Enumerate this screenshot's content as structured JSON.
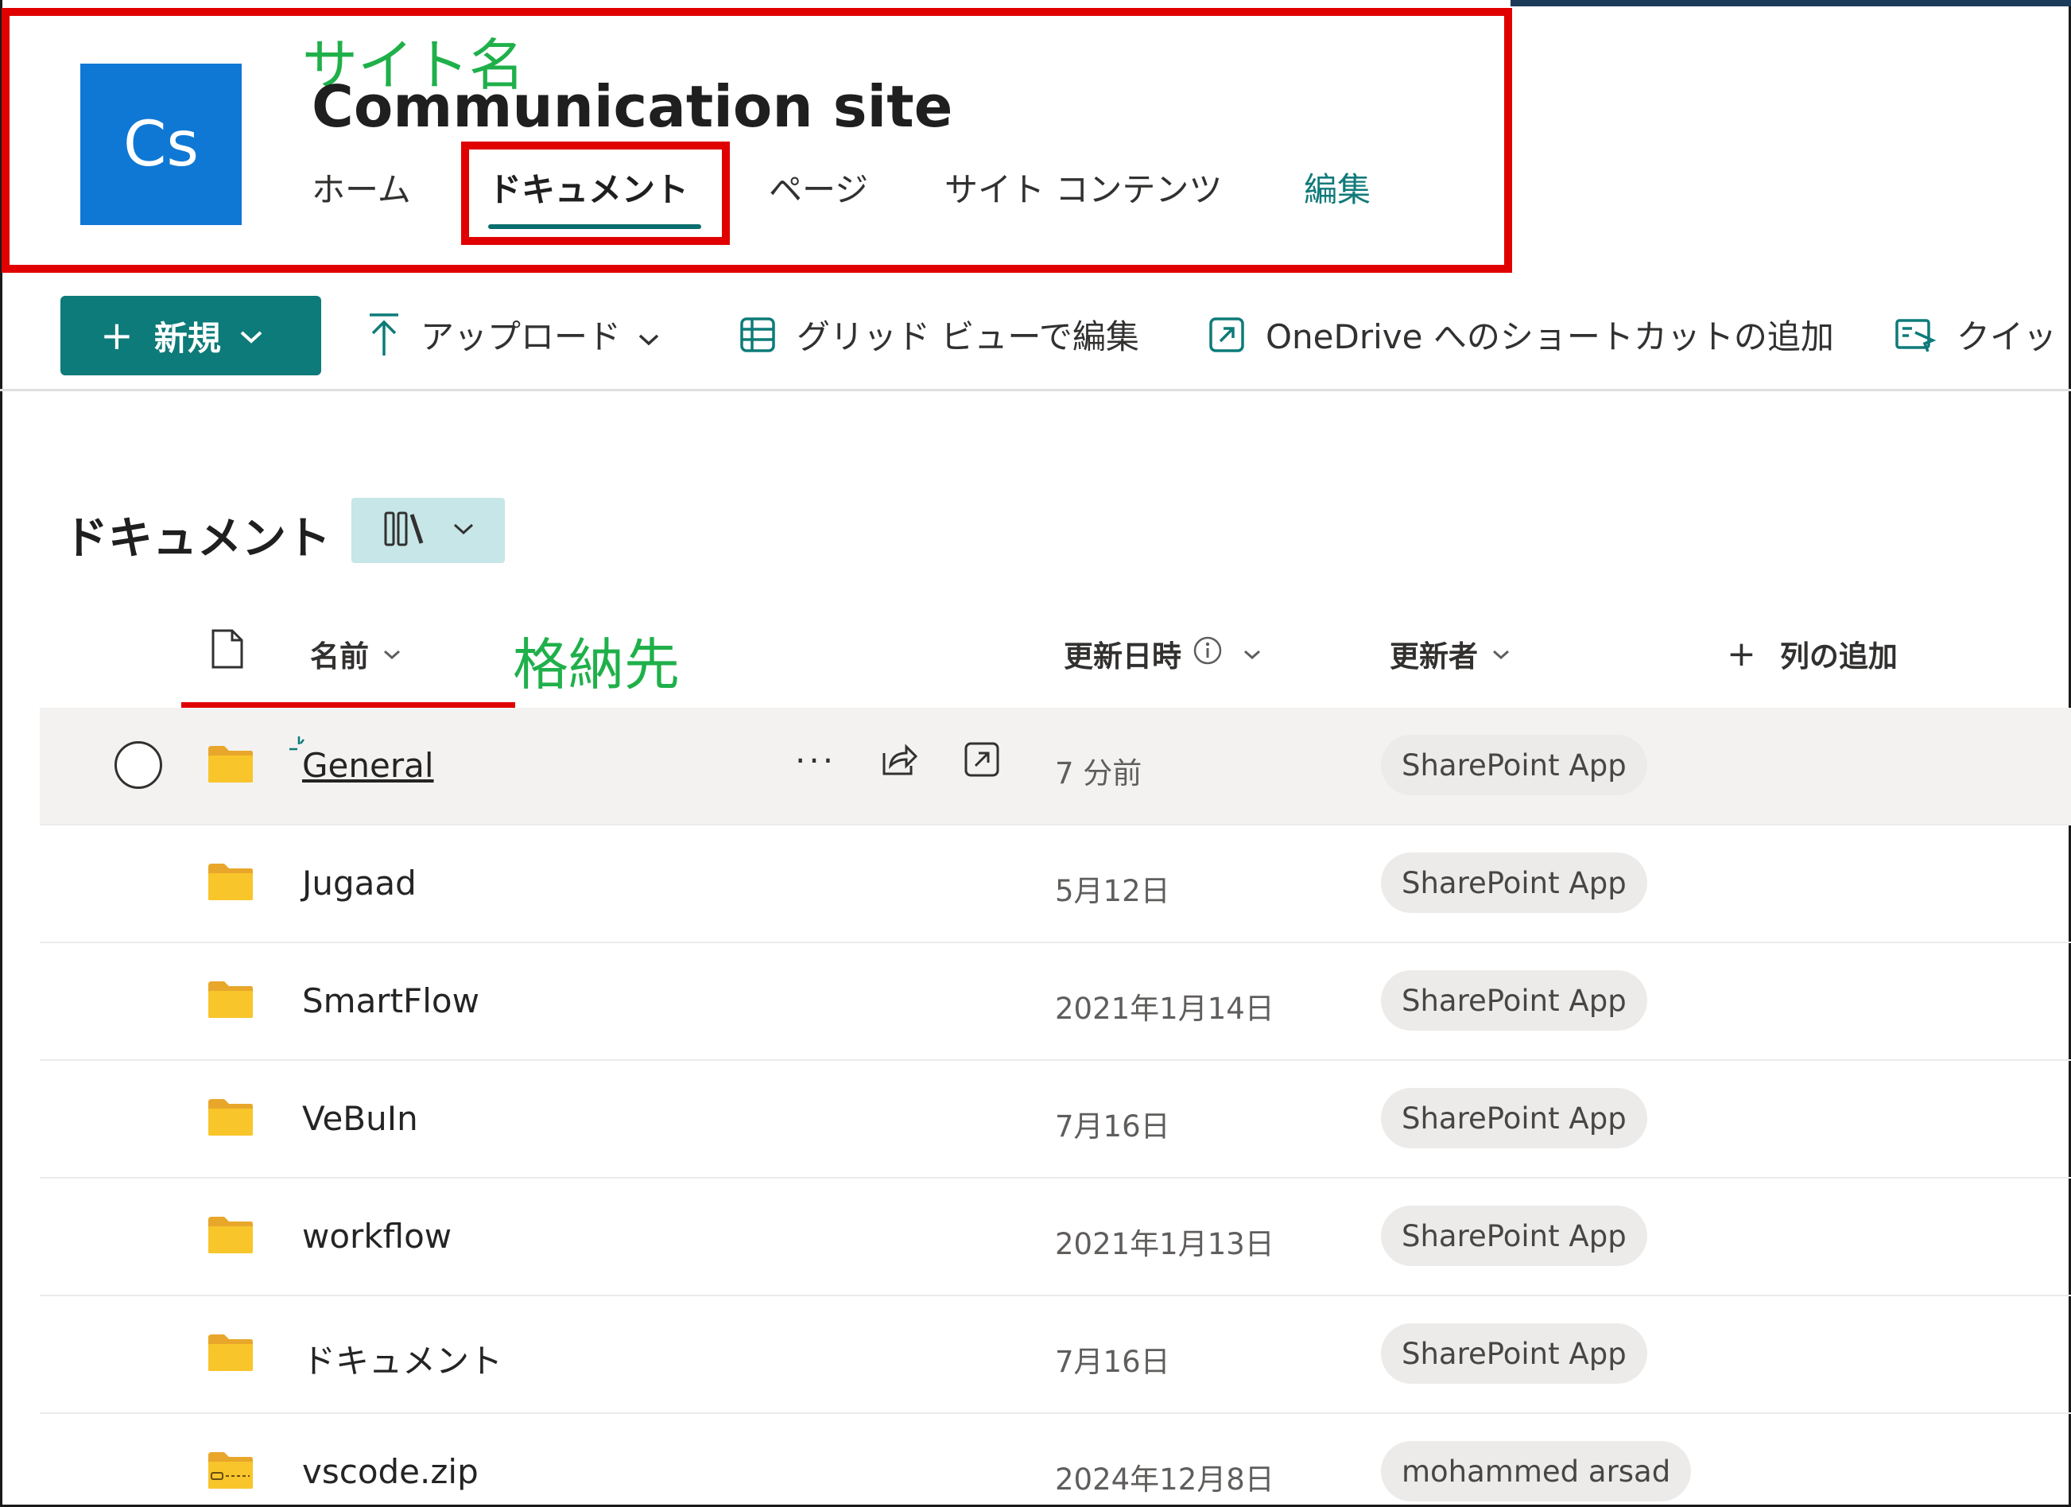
{
  "header": {
    "logo_text": "Cs",
    "site_title": "Communication site",
    "annotation_site": "サイト名",
    "nav": [
      {
        "label": "ホーム"
      },
      {
        "label": "ドキュメント"
      },
      {
        "label": "ページ"
      },
      {
        "label": "サイト コンテンツ"
      },
      {
        "label": "編集"
      }
    ]
  },
  "commandbar": {
    "new": "新規",
    "upload": "アップロード",
    "grid_edit": "グリッド ビューで編集",
    "onedrive_shortcut": "OneDrive へのショートカットの追加",
    "quick": "クイッ"
  },
  "library": {
    "title": "ドキュメント",
    "annotation_dest": "格納先",
    "columns": {
      "name": "名前",
      "modified": "更新日時",
      "modified_by": "更新者",
      "add_column": "列の追加"
    },
    "rows": [
      {
        "name": "General",
        "date": "7 分前",
        "by": "SharePoint App",
        "type": "folder"
      },
      {
        "name": "Jugaad",
        "date": "5月12日",
        "by": "SharePoint App",
        "type": "folder"
      },
      {
        "name": "SmartFlow",
        "date": "2021年1月14日",
        "by": "SharePoint App",
        "type": "folder"
      },
      {
        "name": "VeBuIn",
        "date": "7月16日",
        "by": "SharePoint App",
        "type": "folder"
      },
      {
        "name": "workflow",
        "date": "2021年1月13日",
        "by": "SharePoint App",
        "type": "folder"
      },
      {
        "name": "ドキュメント",
        "date": "7月16日",
        "by": "SharePoint App",
        "type": "folder"
      },
      {
        "name": "vscode.zip",
        "date": "2024年12月8日",
        "by": "mohammed arsad",
        "type": "zip"
      }
    ]
  },
  "colors": {
    "accent": "#0d7b79",
    "logo": "#0f78d4",
    "highlight_box": "#e00000",
    "annotation": "#1fb04a",
    "folder": "#f8c52b"
  }
}
